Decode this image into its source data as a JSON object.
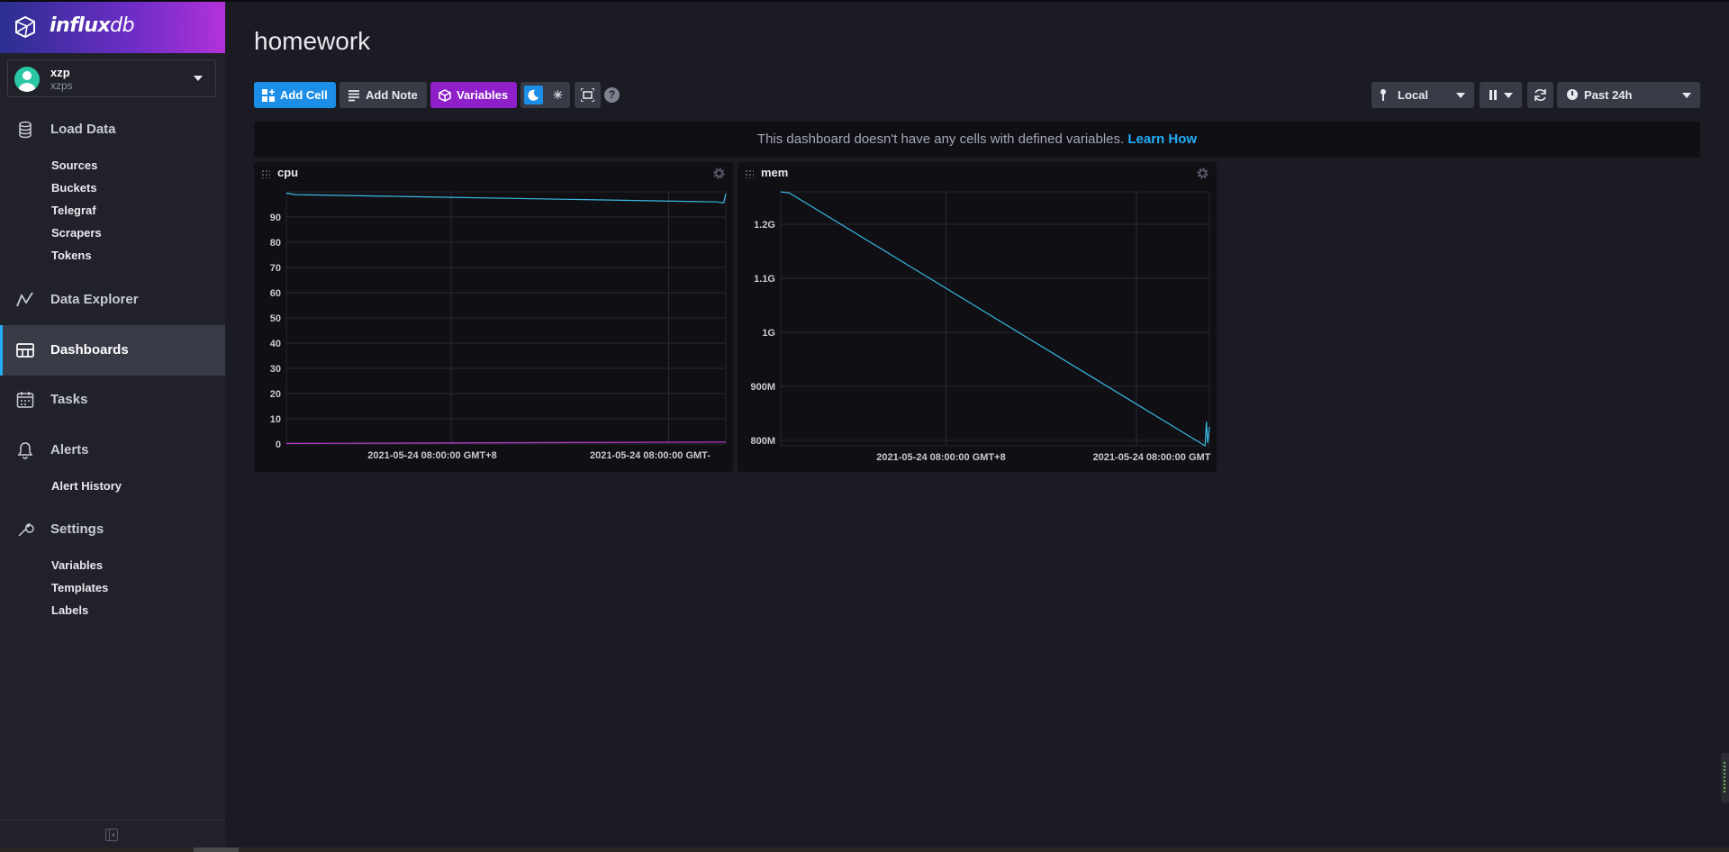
{
  "brand": {
    "name_bold": "influx",
    "name_light": "db"
  },
  "org": {
    "user": "xzp",
    "name": "xzps"
  },
  "nav": {
    "load_data": "Load Data",
    "load_data_items": [
      "Sources",
      "Buckets",
      "Telegraf",
      "Scrapers",
      "Tokens"
    ],
    "data_explorer": "Data Explorer",
    "dashboards": "Dashboards",
    "tasks": "Tasks",
    "alerts": "Alerts",
    "alerts_items": [
      "Alert History"
    ],
    "settings": "Settings",
    "settings_items": [
      "Variables",
      "Templates",
      "Labels"
    ]
  },
  "page": {
    "title": "homework"
  },
  "toolbar": {
    "add_cell": "Add Cell",
    "add_note": "Add Note",
    "variables": "Variables",
    "help": "?",
    "timezone": "Local",
    "time_range": "Past 24h"
  },
  "notice": {
    "text": "This dashboard doesn't have any cells with defined variables.",
    "link": "Learn How"
  },
  "colors": {
    "accent": "#22adf6",
    "primary_button": "#1c8ee8",
    "variables_button": "#8f1fc9",
    "series_1": "#3ab9e0",
    "series_2": "#c13ad6"
  },
  "chart_data": [
    {
      "type": "line",
      "title": "cpu",
      "yticks": [
        "0",
        "10",
        "20",
        "30",
        "40",
        "50",
        "60",
        "70",
        "80",
        "90"
      ],
      "ylim": [
        0,
        100
      ],
      "xticks": [
        "2021-05-24 08:00:00 GMT+8",
        "2021-05-24 08:00:00 GMT-"
      ],
      "series": [
        {
          "x": [
            0,
            0.02,
            0.98,
            0.995,
            1.0
          ],
          "y": [
            99.5,
            98.9,
            96.0,
            95.6,
            99.3
          ]
        },
        {
          "x": [
            0,
            1.0
          ],
          "y": [
            0.2,
            0.8
          ]
        }
      ]
    },
    {
      "type": "line",
      "title": "mem",
      "yticks": [
        "800M",
        "900M",
        "1G",
        "1.1G",
        "1.2G"
      ],
      "ylim": [
        790,
        1260
      ],
      "xticks": [
        "2021-05-24 08:00:00 GMT+8",
        "2021-05-24 08:00:00 GMT"
      ],
      "series": [
        {
          "x": [
            0,
            0.02,
            0.99,
            0.993,
            0.996,
            1.0
          ],
          "y": [
            1260,
            1258,
            790,
            835,
            795,
            825
          ]
        }
      ]
    }
  ]
}
